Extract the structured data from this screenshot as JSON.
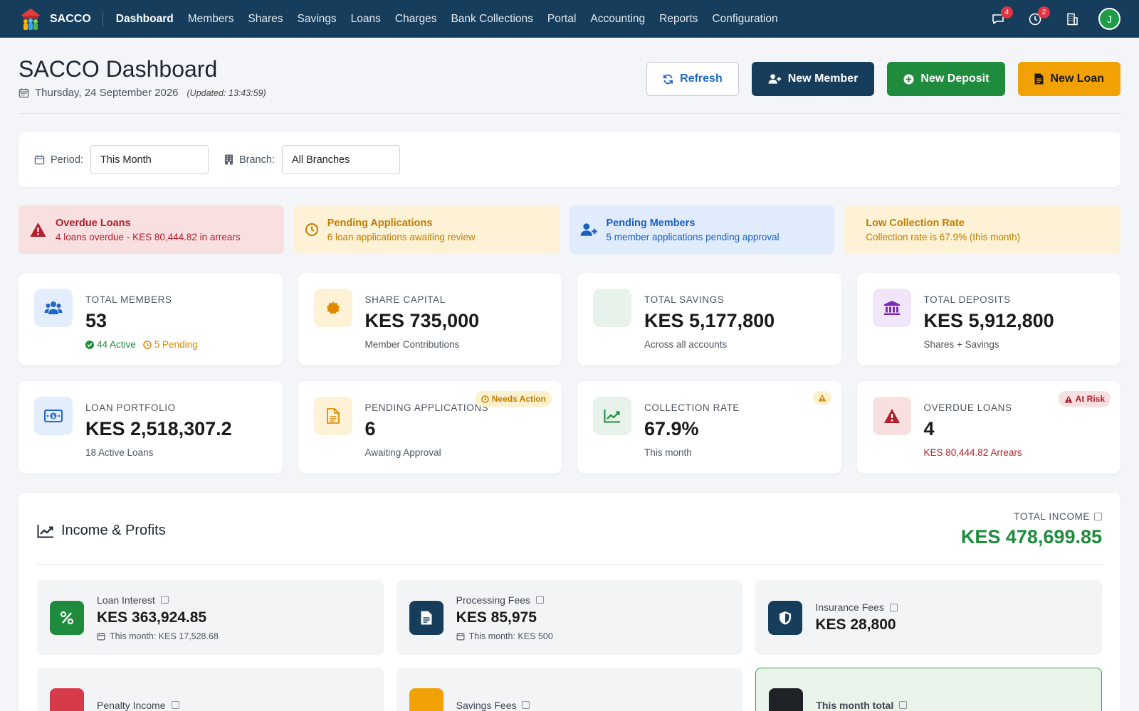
{
  "nav": {
    "brand": "SACCO",
    "links": [
      "Dashboard",
      "Members",
      "Shares",
      "Savings",
      "Loans",
      "Charges",
      "Bank Collections",
      "Portal",
      "Accounting",
      "Reports",
      "Configuration"
    ],
    "messages_count": "4",
    "pending_count": "2",
    "avatar_initial": "J"
  },
  "header": {
    "title": "SACCO Dashboard",
    "date": "Thursday, 24 September 2026",
    "updated": "(Updated: 13:43:59)",
    "refresh_label": "Refresh",
    "new_member_label": "New Member",
    "new_deposit_label": "New Deposit",
    "new_loan_label": "New Loan"
  },
  "filters": {
    "period_label": "Period:",
    "period_value": "This Month",
    "branch_label": "Branch:",
    "branch_value": "All Branches"
  },
  "alerts": [
    {
      "title": "Overdue Loans",
      "text": "4 loans overdue - KES 80,444.82 in arrears"
    },
    {
      "title": "Pending Applications",
      "text": "6 loan applications awaiting review"
    },
    {
      "title": "Pending Members",
      "text": "5 member applications pending approval"
    },
    {
      "title": "Low Collection Rate",
      "text": "Collection rate is 67.9% (this month)"
    }
  ],
  "stats": {
    "total_members": {
      "label": "TOTAL MEMBERS",
      "value": "53",
      "active": "44 Active",
      "pending": "5 Pending"
    },
    "share_capital": {
      "label": "SHARE CAPITAL",
      "value": "KES 735,000",
      "sub": "Member Contributions"
    },
    "total_savings": {
      "label": "TOTAL SAVINGS",
      "value": "KES 5,177,800",
      "sub": "Across all accounts"
    },
    "total_deposits": {
      "label": "TOTAL DEPOSITS",
      "value": "KES 5,912,800",
      "sub": "Shares + Savings"
    },
    "loan_portfolio": {
      "label": "LOAN PORTFOLIO",
      "value": "KES 2,518,307.2",
      "sub": "18 Active Loans"
    },
    "pending_applications": {
      "label": "PENDING APPLICATIONS",
      "value": "6",
      "sub": "Awaiting Approval",
      "badge": "Needs Action"
    },
    "collection_rate": {
      "label": "COLLECTION RATE",
      "value": "67.9%",
      "sub": "This month"
    },
    "overdue_loans": {
      "label": "OVERDUE LOANS",
      "value": "4",
      "sub": "KES 80,444.82 Arrears",
      "badge": "At Risk"
    }
  },
  "income": {
    "title": "Income & Profits",
    "total_label": "TOTAL INCOME",
    "total_value": "KES 478,699.85",
    "items": [
      {
        "label": "Loan Interest",
        "value": "KES 363,924.85",
        "sub": "This month: KES 17,528.68"
      },
      {
        "label": "Processing Fees",
        "value": "KES 85,975",
        "sub": "This month: KES 500"
      },
      {
        "label": "Insurance Fees",
        "value": "KES 28,800"
      },
      {
        "label": "Penalty Income"
      },
      {
        "label": "Savings Fees"
      },
      {
        "label": "This month total"
      }
    ]
  },
  "colors": {
    "navbar": "#163e5c",
    "success": "#1e8c3c",
    "warning": "#f1a104",
    "danger": "#b1202c",
    "info": "#1c60c0"
  }
}
